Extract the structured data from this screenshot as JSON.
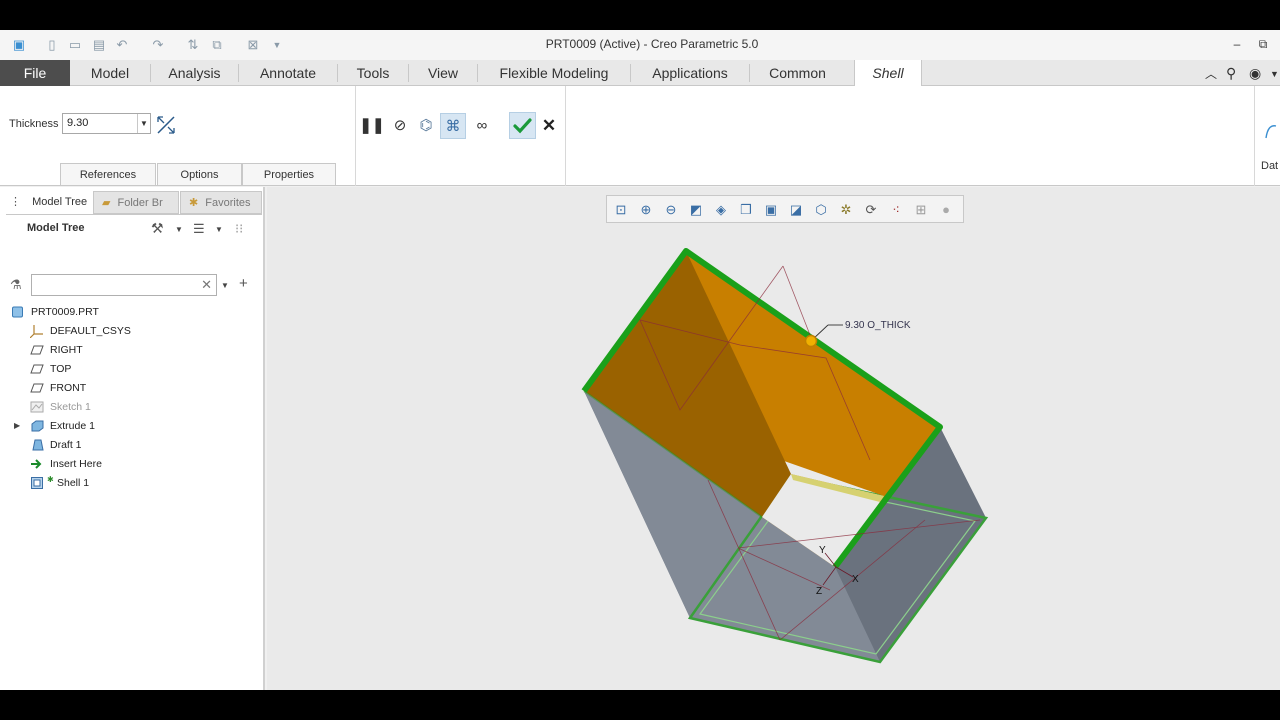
{
  "window": {
    "title": "PRT0009 (Active) - Creo Parametric 5.0",
    "minimize": "–",
    "restore": "⧉"
  },
  "quick_access": [
    "app-icon",
    "new-icon",
    "open-icon",
    "save-icon",
    "undo-icon",
    "redo-icon",
    "regenerate-icon",
    "windows-icon",
    "close-icon",
    "customize-icon"
  ],
  "tabs": [
    {
      "label": "File"
    },
    {
      "label": "Model"
    },
    {
      "label": "Analysis"
    },
    {
      "label": "Annotate"
    },
    {
      "label": "Tools"
    },
    {
      "label": "View"
    },
    {
      "label": "Flexible Modeling"
    },
    {
      "label": "Applications"
    },
    {
      "label": "Common"
    },
    {
      "label": "Shell"
    }
  ],
  "shell_dashboard": {
    "thickness_label": "Thickness",
    "thickness_value": "9.30",
    "sub_tabs": [
      "References",
      "Options",
      "Properties"
    ],
    "partial_label": "Dat"
  },
  "model_tree": {
    "tabs": [
      "Model Tree",
      "Folder Br",
      "Favorites"
    ],
    "header": "Model Tree",
    "search_placeholder": "",
    "items": [
      {
        "label": "PRT0009.PRT",
        "icon": "part-icon"
      },
      {
        "label": "DEFAULT_CSYS",
        "icon": "csys-icon"
      },
      {
        "label": "RIGHT",
        "icon": "datum-plane-icon"
      },
      {
        "label": "TOP",
        "icon": "datum-plane-icon"
      },
      {
        "label": "FRONT",
        "icon": "datum-plane-icon"
      },
      {
        "label": "Sketch 1",
        "icon": "sketch-icon"
      },
      {
        "label": "Extrude 1",
        "icon": "extrude-icon"
      },
      {
        "label": "Draft 1",
        "icon": "draft-icon"
      },
      {
        "label": "Insert Here",
        "icon": "insert-arrow-icon"
      },
      {
        "label": "Shell 1",
        "icon": "shell-icon"
      }
    ]
  },
  "viewport": {
    "dimension_label": "9.30 O_THICK",
    "axes": {
      "x": "X",
      "y": "Y",
      "z": "Z"
    },
    "toolbar_icons": [
      "refit-icon",
      "zoom-in-icon",
      "zoom-out-icon",
      "repaint-icon",
      "display-style-icon",
      "saved-orientations-icon",
      "view-manager-icon",
      "perspective-icon",
      "datum-display-icon",
      "annotation-display-icon",
      "spin-center-icon",
      "point-display-icon",
      "csys-display-icon",
      "hidden-line-icon"
    ]
  },
  "colors": {
    "shell_face": "#c87f00",
    "shell_edge": "#1aa01a",
    "body_gray": "#7d8591",
    "file_tab": "#4d4d4d"
  }
}
